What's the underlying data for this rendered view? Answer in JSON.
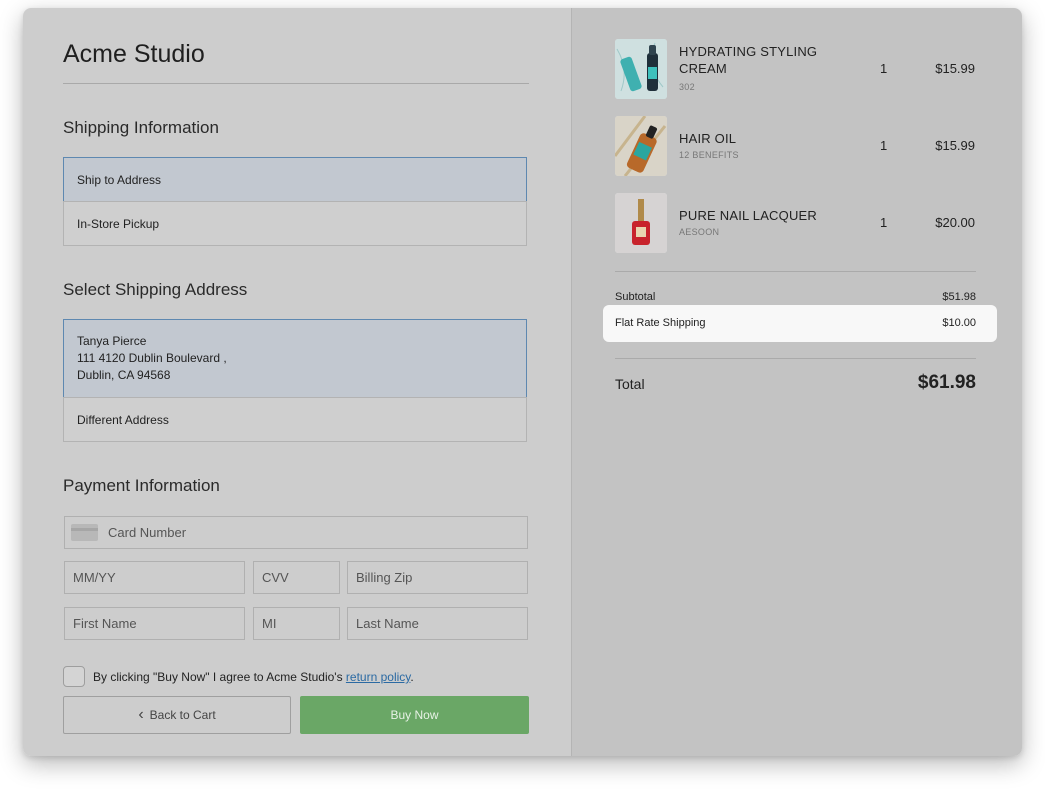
{
  "brand": "Acme Studio",
  "shipping": {
    "title": "Shipping Information",
    "options": [
      "Ship to Address",
      "In-Store Pickup"
    ]
  },
  "address": {
    "title": "Select Shipping Address",
    "selected": {
      "name": "Tanya Pierce",
      "line1": "111 4120 Dublin Boulevard ,",
      "line2": "Dublin, CA 94568"
    },
    "other": "Different Address"
  },
  "payment": {
    "title": "Payment Information",
    "card_placeholder": "Card Number",
    "expiry_placeholder": "MM/YY",
    "cvv_placeholder": "CVV",
    "zip_placeholder": "Billing Zip",
    "first_placeholder": "First Name",
    "mi_placeholder": "MI",
    "last_placeholder": "Last Name"
  },
  "agreement": {
    "text": "By clicking \"Buy Now\" I agree to Acme Studio's ",
    "link": "return policy",
    "end": "."
  },
  "buttons": {
    "back": "Back to Cart",
    "buy": "Buy Now"
  },
  "cart": {
    "items": [
      {
        "name": "HYDRATING STYLING CREAM",
        "sub": "302",
        "qty": "1",
        "price": "$15.99",
        "icon": "hair-cream-product-image"
      },
      {
        "name": "HAIR OIL",
        "sub": "12 BENEFITS",
        "qty": "1",
        "price": "$15.99",
        "icon": "hair-oil-product-image"
      },
      {
        "name": "PURE NAIL LACQUER",
        "sub": "AESOON",
        "qty": "1",
        "price": "$20.00",
        "icon": "nail-lacquer-product-image"
      }
    ],
    "subtotal_label": "Subtotal",
    "subtotal": "$51.98",
    "shipping_label": "Flat Rate Shipping",
    "shipping": "$10.00",
    "total_label": "Total",
    "total": "$61.98"
  },
  "colors": {
    "buy_button": "#6aa766",
    "selected_border": "#5e88b0",
    "link": "#2b6aa3"
  }
}
